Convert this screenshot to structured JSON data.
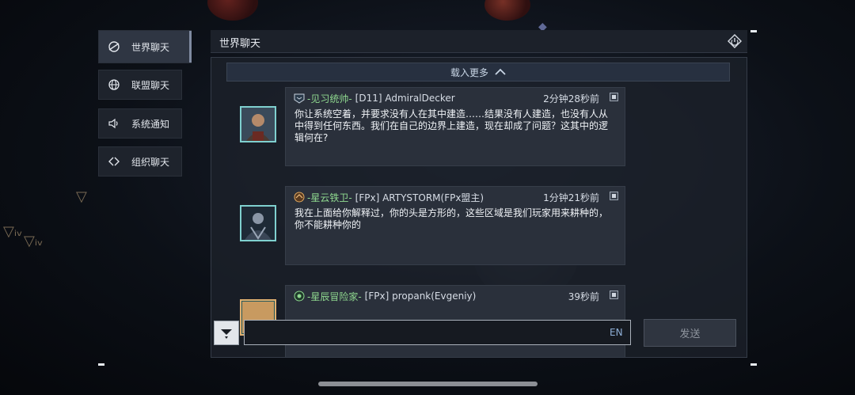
{
  "sidebar": {
    "items": [
      {
        "label": "世界聊天",
        "icon": "world-chat-icon",
        "active": true
      },
      {
        "label": "联盟聊天",
        "icon": "globe-icon",
        "active": false
      },
      {
        "label": "系统通知",
        "icon": "speaker-icon",
        "active": false
      },
      {
        "label": "组织聊天",
        "icon": "organization-icon",
        "active": false
      }
    ]
  },
  "panel": {
    "title": "世界聊天",
    "load_more": "载入更多"
  },
  "messages": [
    {
      "rank": "-见习统帅-",
      "sender": "[D11] AdmiralDecker",
      "time": "2分钟28秒前",
      "text": "你让系统空着，并要求没有人在其中建造……结果没有人建造，也没有人从中得到任何东西。我们在自己的边界上建造，现在却成了问题？这其中的逻辑何在?"
    },
    {
      "rank": "-星云铁卫-",
      "sender": "[FPx] ARTYSTORM(FPx盟主)",
      "time": "1分钟21秒前",
      "text": "我在上面给你解释过，你的头是方形的，这些区域是我们玩家用来耕种的，你不能耕种你的"
    },
    {
      "rank": "-星辰冒险家-",
      "sender": "[FPx] propank(Evgeniy)",
      "time": "39秒前",
      "text": ""
    }
  ],
  "input": {
    "value": "",
    "placeholder": "",
    "language": "EN"
  },
  "send_label": "发送",
  "colors": {
    "rank_green": "#8fd98f",
    "avatar_border": "#7fd0cf",
    "panel_bg": "#1c212a",
    "accent_blue": "#8fb0d8"
  }
}
